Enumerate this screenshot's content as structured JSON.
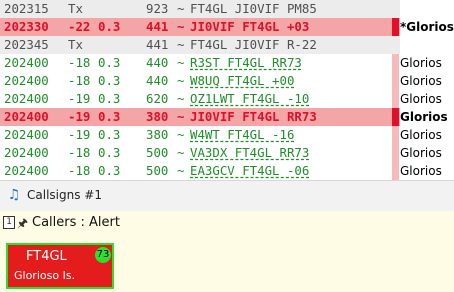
{
  "log_rows": [
    {
      "kind": "tx",
      "time": "202315",
      "db": "Tx",
      "dt": "",
      "freq": "923",
      "sep": "~",
      "message": "FT4GL JI0VIF PM85",
      "marker": "none",
      "country": "",
      "country_bold": false
    },
    {
      "kind": "alert",
      "time": "202330",
      "db": "-22",
      "dt": "0.3",
      "freq": "441",
      "sep": "~",
      "message": "JI0VIF FT4GL +03",
      "marker": "dark",
      "country": "*Glorios",
      "country_bold": true
    },
    {
      "kind": "tx",
      "time": "202345",
      "db": "Tx",
      "dt": "",
      "freq": "441",
      "sep": "~",
      "message": "FT4GL JI0VIF R-22",
      "marker": "none",
      "country": "",
      "country_bold": false
    },
    {
      "kind": "rx",
      "time": "202400",
      "db": "-18",
      "dt": "0.3",
      "freq": "440",
      "sep": "~",
      "message": "R3ST FT4GL RR73",
      "marker": "light",
      "country": "Glorios",
      "country_bold": false
    },
    {
      "kind": "rx",
      "time": "202400",
      "db": "-18",
      "dt": "0.3",
      "freq": "440",
      "sep": "~",
      "message": "W8UQ FT4GL +00",
      "marker": "light",
      "country": "Glorios",
      "country_bold": false
    },
    {
      "kind": "rx",
      "time": "202400",
      "db": "-19",
      "dt": "0.3",
      "freq": "620",
      "sep": "~",
      "message": "OZ1LWT FT4GL -10",
      "marker": "light",
      "country": "Glorios",
      "country_bold": false
    },
    {
      "kind": "alert",
      "time": "202400",
      "db": "-19",
      "dt": "0.3",
      "freq": "380",
      "sep": "~",
      "message": "JI0VIF FT4GL RR73",
      "marker": "dark",
      "country": "Glorios",
      "country_bold": true
    },
    {
      "kind": "rx",
      "time": "202400",
      "db": "-19",
      "dt": "0.3",
      "freq": "380",
      "sep": "~",
      "message": "W4WT FT4GL -16",
      "marker": "light",
      "country": "Glorios",
      "country_bold": false
    },
    {
      "kind": "rx",
      "time": "202400",
      "db": "-18",
      "dt": "0.3",
      "freq": "500",
      "sep": "~",
      "message": "VA3DX FT4GL RR73",
      "marker": "light",
      "country": "Glorios",
      "country_bold": false
    },
    {
      "kind": "rx",
      "time": "202400",
      "db": "-18",
      "dt": "0.3",
      "freq": "500",
      "sep": "~",
      "message": "EA3GCV FT4GL -06",
      "marker": "light",
      "country": "Glorios",
      "country_bold": false
    }
  ],
  "tabbar": {
    "icon": "music-note-icon",
    "label": "Callsigns #1"
  },
  "panel": {
    "number_icon": "1",
    "pin_icon": "pin-icon",
    "title": "Callers : Alert"
  },
  "card": {
    "callsign": "FT4GL",
    "country": "Glorioso Is.",
    "badge": "73"
  },
  "colors": {
    "alert_row": "#f4a6a6",
    "alert_text": "#e0102a",
    "rx_text": "#1f8f2a",
    "card_bg": "#e31c1c",
    "card_border": "#2ee02e",
    "panel_bg": "#fffce6"
  }
}
